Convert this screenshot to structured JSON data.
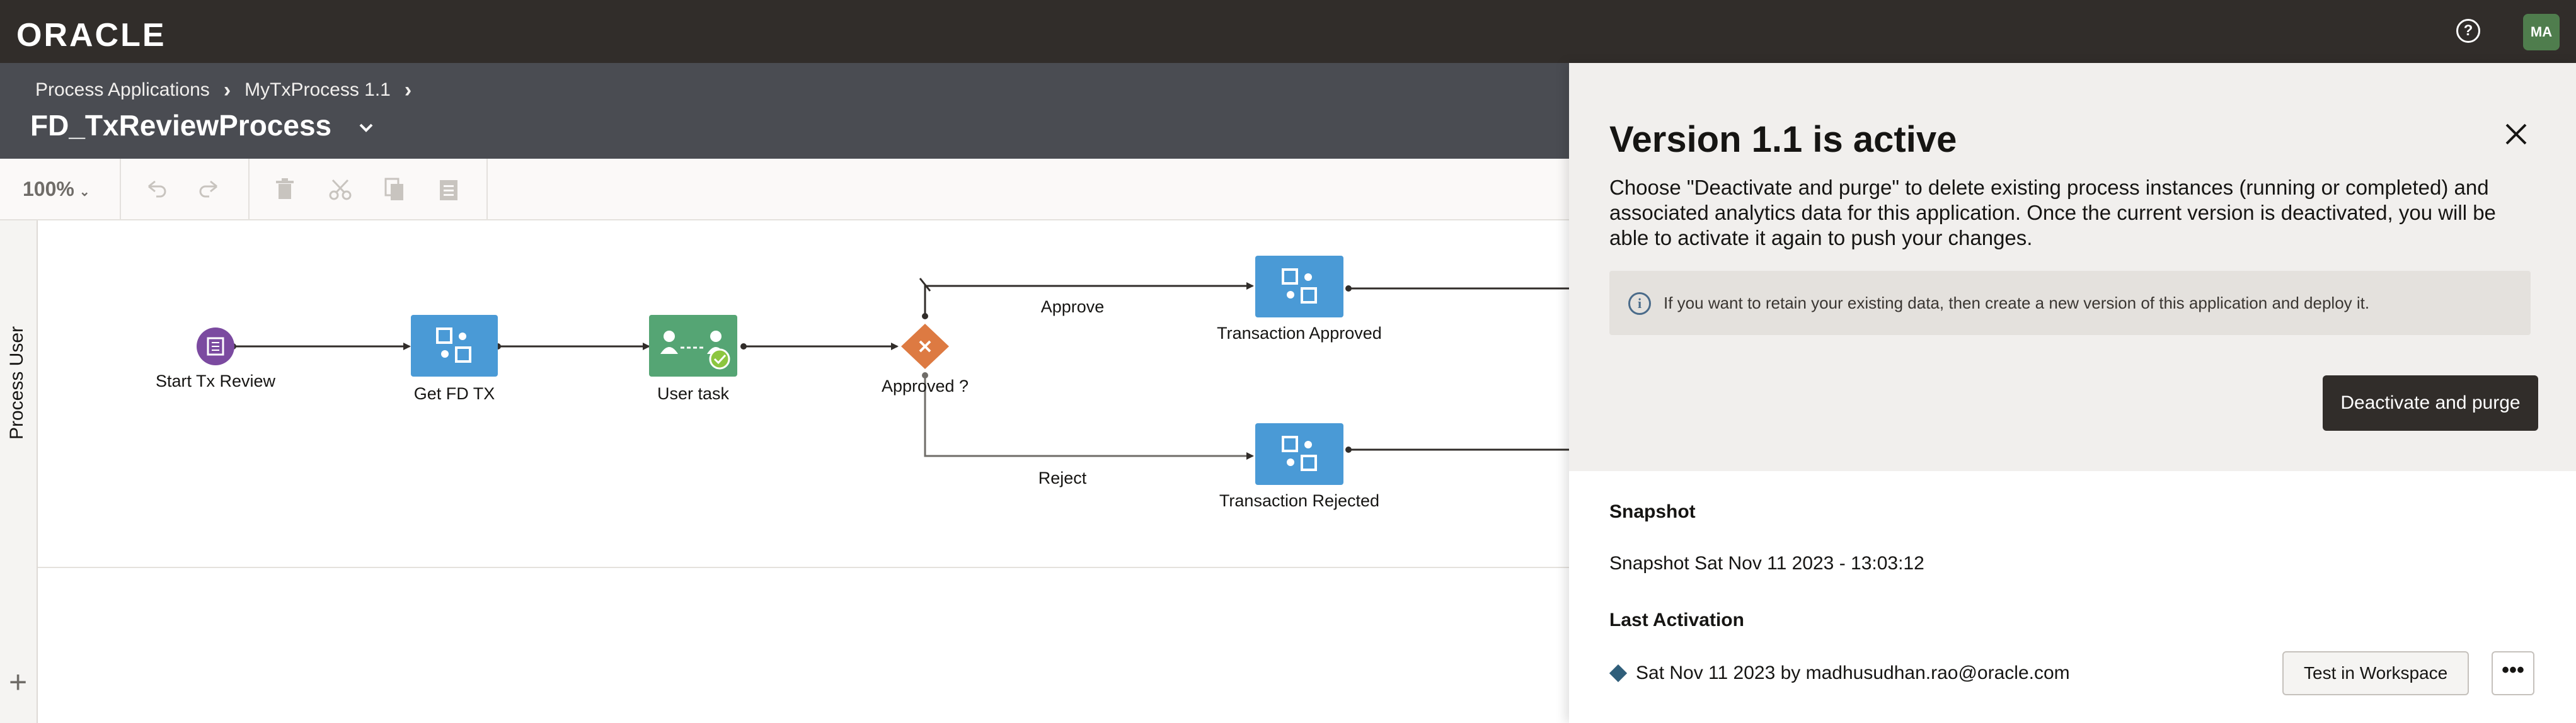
{
  "topbar": {
    "logo": "ORACLE",
    "help_icon": "question-circle-icon",
    "avatar_initials": "MA"
  },
  "header": {
    "breadcrumb": [
      "Process Applications",
      "MyTxProcess 1.1"
    ],
    "title": "FD_TxReviewProcess"
  },
  "toolbar": {
    "zoom": "100%",
    "icons": [
      "undo-icon",
      "redo-icon",
      "delete-icon",
      "cut-icon",
      "copy-icon",
      "paste-icon"
    ]
  },
  "canvas": {
    "lane_title": "Process User",
    "nodes": {
      "start": "Start Tx Review",
      "get_fd_tx": "Get FD TX",
      "user_task": "User task",
      "gateway": "Approved ?",
      "approved": "Transaction Approved",
      "rejected": "Transaction Rejected"
    },
    "flows": {
      "approve": "Approve",
      "reject": "Reject"
    },
    "colors": {
      "start": "#7b4aa0",
      "service": "#4a9ad6",
      "user_task": "#55a574",
      "gateway": "#dd7a42"
    }
  },
  "panel": {
    "title": "Version 1.1 is active",
    "description": "Choose \"Deactivate and purge\" to delete existing process instances (running or completed) and associated analytics data for this application. Once the current version is deactivated, you will be able to activate it again to push your changes.",
    "info": "If you want to retain your existing data, then create a new version of this application and deploy it.",
    "deactivate_label": "Deactivate and purge",
    "snapshot_heading": "Snapshot",
    "snapshot_value": "Snapshot Sat Nov 11 2023 - 13:03:12",
    "last_activation_heading": "Last Activation",
    "last_activation_value": "Sat Nov 11 2023 by madhusudhan.rao@oracle.com",
    "test_label": "Test in Workspace",
    "more_label": "•••"
  }
}
